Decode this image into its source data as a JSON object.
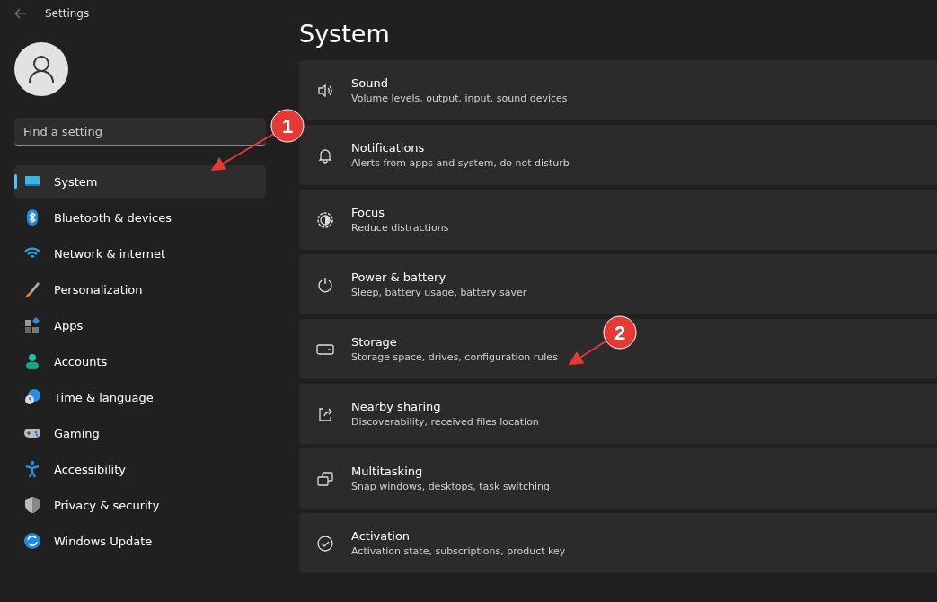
{
  "window": {
    "title": "Settings"
  },
  "sidebar": {
    "search": {
      "placeholder": "Find a setting"
    },
    "items": [
      {
        "label": "System",
        "selected": true
      },
      {
        "label": "Bluetooth & devices",
        "selected": false
      },
      {
        "label": "Network & internet",
        "selected": false
      },
      {
        "label": "Personalization",
        "selected": false
      },
      {
        "label": "Apps",
        "selected": false
      },
      {
        "label": "Accounts",
        "selected": false
      },
      {
        "label": "Time & language",
        "selected": false
      },
      {
        "label": "Gaming",
        "selected": false
      },
      {
        "label": "Accessibility",
        "selected": false
      },
      {
        "label": "Privacy & security",
        "selected": false
      },
      {
        "label": "Windows Update",
        "selected": false
      }
    ]
  },
  "main": {
    "heading": "System",
    "cards": [
      {
        "title": "Sound",
        "subtitle": "Volume levels, output, input, sound devices"
      },
      {
        "title": "Notifications",
        "subtitle": "Alerts from apps and system, do not disturb"
      },
      {
        "title": "Focus",
        "subtitle": "Reduce distractions"
      },
      {
        "title": "Power & battery",
        "subtitle": "Sleep, battery usage, battery saver"
      },
      {
        "title": "Storage",
        "subtitle": "Storage space, drives, configuration rules"
      },
      {
        "title": "Nearby sharing",
        "subtitle": "Discoverability, received files location"
      },
      {
        "title": "Multitasking",
        "subtitle": "Snap windows, desktops, task switching"
      },
      {
        "title": "Activation",
        "subtitle": "Activation state, subscriptions, product key"
      }
    ]
  },
  "annotations": [
    {
      "label": "1"
    },
    {
      "label": "2"
    }
  ]
}
